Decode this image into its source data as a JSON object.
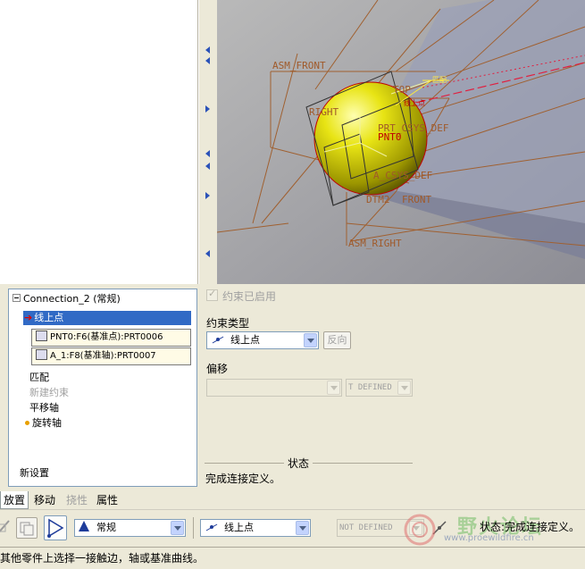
{
  "viewport": {
    "labels": {
      "asm_front": "ASM_FRONT",
      "right": "RIGHT",
      "top": "TOP",
      "prt_csys": "PRT_CSYS_DEF",
      "pnt0": "PNT0",
      "acs_csys": "A_CSYS_DEF",
      "dtm2": "DTM2",
      "front": "FRONT",
      "asm_right": "ASM_RIGHT",
      "tag_pnt": "线上点",
      "tag_yellow": "匹配"
    }
  },
  "tree": {
    "root": "Connection_2 (常规)",
    "selected": "线上点",
    "refs": [
      "PNT0:F6(基准点):PRT0006",
      "A_1:F8(基准轴):PRT0007"
    ],
    "items": [
      {
        "label": "匹配",
        "disabled": false
      },
      {
        "label": "新建约束",
        "disabled": true
      },
      {
        "label": "平移轴",
        "disabled": false
      },
      {
        "label": "旋转轴",
        "disabled": false
      }
    ],
    "new_set": "新设置"
  },
  "props": {
    "enabled_label": "约束已启用",
    "type_label": "约束类型",
    "type_value": "线上点",
    "flip_button": "反向",
    "offset_label": "偏移",
    "offset_value": "",
    "offset_mode": "T DEFINED",
    "status_title": "状态",
    "status_text": "完成连接定义。"
  },
  "tabs": [
    "放置",
    "移动",
    "挠性",
    "属性"
  ],
  "toolbar": {
    "connection_type": "常规",
    "constraint_type": "线上点",
    "offset_mode": "NOT DEFINED",
    "status": "状态:完成连接定义。"
  },
  "watermark": {
    "title": "野火论坛",
    "url": "www.proewildfire.cn"
  },
  "statusbar": {
    "message": "其他零件上选择一接触边，轴或基准曲线。"
  }
}
